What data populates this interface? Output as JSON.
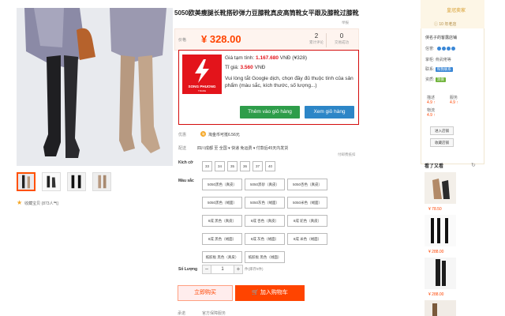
{
  "product": {
    "title": "5050欧美瘦腿长靴搭砂弹力豆膝靴真皮高筒靴女平跟及膝靴过膝靴",
    "price_label": "价格",
    "price": "328.00",
    "side_tag": "举报",
    "stats": [
      {
        "num": "2",
        "label": "累计评论"
      },
      {
        "num": "0",
        "label": "交易成功"
      }
    ],
    "favorite": "收藏宝贝 (873人气)"
  },
  "extension": {
    "brand": "SONG PHUONG",
    "brand_sub": "TRADE",
    "est_label": "Giá tạm tính: ",
    "est_value": "1.167.680",
    "est_suffix": " VNĐ (¥328)",
    "rate_label": "Tỉ giá: ",
    "rate_value": "3.560",
    "rate_suffix": " VNĐ",
    "note": "Vui lòng tắt Google dịch, chọn đầy đủ thuộc tính của sản phẩm (màu sắc, kích thước, số lượng...)",
    "add_cart": "Thêm vào giỏ hàng",
    "view_cart": "Xem giỏ hàng"
  },
  "meta": {
    "promo_label": "优惠",
    "promo_coin": "淘",
    "promo_text": "淘金币可抵6.56元",
    "ship_label": "配送",
    "ship_text": "四川成都 至  全国 ▾  快递 免运费 ▾  付款后45天内发货",
    "ship_extra": "付邮费抵扣",
    "size_label": "Kích cỡ",
    "sizes": [
      "33",
      "34",
      "35",
      "36",
      "37",
      "40"
    ],
    "color_label": "Màu sắc",
    "colors": [
      "5050黑色（真皮）",
      "5050黑砂（真皮）",
      "5050杏色（真皮）",
      "5050黑色（绒面）",
      "5050灰色（绒面）",
      "5050米色（绒面）",
      "8成 黑色（真皮）",
      "8成 杏色（真皮）",
      "8成 驼色（真皮）",
      "8成 黑色（绒面）",
      "8成 灰色（绒面）",
      "8成 米色（绒面）",
      "纸胶板 黑色（真皮）",
      "纸胶板 黑色（绒面）"
    ],
    "qty_label": "Số Lượng",
    "qty_minus": "−",
    "qty_value": "1",
    "qty_plus": "+",
    "stock": "件(库存9件)",
    "buy_now": "立即购买",
    "add_cart": "加入购物车",
    "bottom_label": "承诺",
    "bottom_val": "官方保障服务"
  },
  "shop": {
    "crown": "皇冠卖家",
    "years": "10 年老店",
    "name": "侠名子的客露店铺",
    "rating_label": "信誉:",
    "owner_label": "掌柜:",
    "owner_val": "骨武佬等",
    "contact_label": "联系:",
    "contact_badge": "和我联系",
    "quality_label": "资质:",
    "quality_badge": "消保",
    "scores": [
      {
        "label": "描述",
        "value": "4.9 ↑"
      },
      {
        "label": "服务",
        "value": "4.9 ↑"
      },
      {
        "label": "物流",
        "value": "4.9 ↑"
      }
    ],
    "btn_enter": "进入店铺",
    "btn_collect": "收藏店铺",
    "seen_title": "看了又看",
    "refresh": "↻",
    "seen": [
      {
        "price": "¥ 78.50"
      },
      {
        "price": "¥ 288.00"
      },
      {
        "price": "¥ 288.00"
      }
    ]
  },
  "colors": {
    "accent": "#ff4400",
    "ext_red": "#e3141b",
    "btn_green": "#2e9d4a",
    "btn_blue": "#2d86c7"
  }
}
